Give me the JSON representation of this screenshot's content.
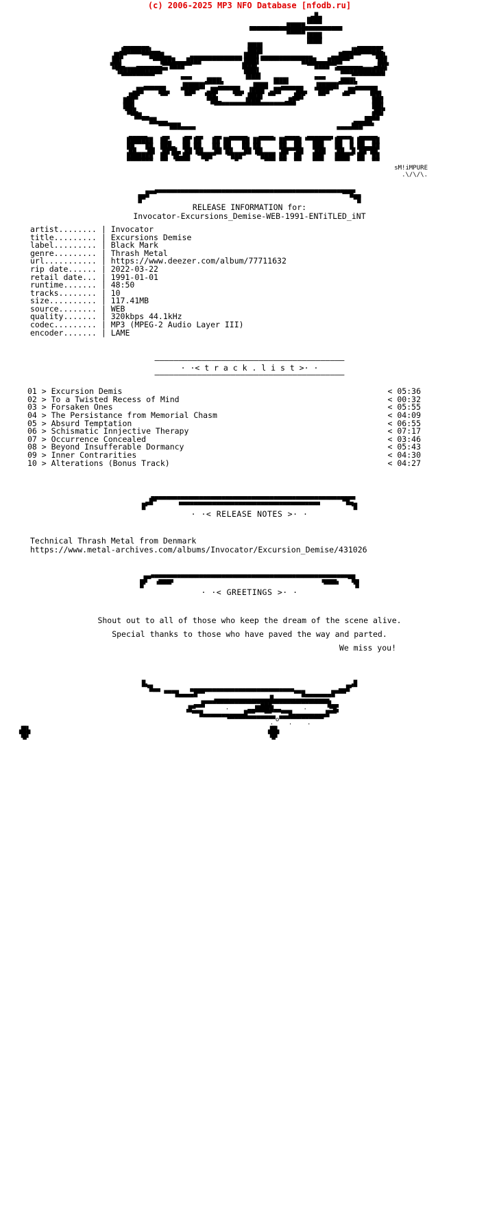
{
  "header": {
    "copyright": "(c) 2006-2025 MP3 NFO Database [nfodb.ru]",
    "color": "#e00000"
  },
  "logo": {
    "name": "invocator-ascii-logo",
    "signature_line1": "sM!iMPURE",
    "signature_line2": ".\\/\\/\\."
  },
  "release": {
    "heading": "RELEASE INFORMATION for:",
    "dirname": "Invocator-Excursions_Demise-WEB-1991-ENTiTLED_iNT",
    "fields": [
      {
        "label": "artist........",
        "sep": "|",
        "value": "Invocator"
      },
      {
        "label": "title.........",
        "sep": "|",
        "value": "Excursions Demise"
      },
      {
        "label": "label.........",
        "sep": "|",
        "value": "Black Mark"
      },
      {
        "label": "genre.........",
        "sep": "|",
        "value": "Thrash Metal"
      },
      {
        "label": "url...........",
        "sep": "|",
        "value": "https://www.deezer.com/album/77711632"
      },
      {
        "label": "rip date......",
        "sep": "|",
        "value": "2022-03-22"
      },
      {
        "label": "retail date...",
        "sep": "|",
        "value": "1991-01-01"
      },
      {
        "label": "runtime.......",
        "sep": "|",
        "value": "48:50"
      },
      {
        "label": "tracks........",
        "sep": "|",
        "value": "10"
      },
      {
        "label": "size..........",
        "sep": "|",
        "value": "117.41MB"
      },
      {
        "label": "source........",
        "sep": "|",
        "value": "WEB"
      },
      {
        "label": "quality.......",
        "sep": "|",
        "value": "320kbps 44.1kHz"
      },
      {
        "label": "codec.........",
        "sep": "|",
        "value": "MP3 (MPEG-2 Audio Layer III)"
      },
      {
        "label": "encoder.......",
        "sep": "|",
        "value": "LAME"
      }
    ]
  },
  "tracklist": {
    "title": "· ·< t r a c k . l i s t >· ·",
    "rule": "————————————————————————————————————————",
    "tracks": [
      {
        "num": "01",
        "marker": ">",
        "title": "Excursion Demis",
        "bracket": "<",
        "time": "05:36"
      },
      {
        "num": "02",
        "marker": ">",
        "title": "To a Twisted Recess of Mind",
        "bracket": "<",
        "time": "00:32"
      },
      {
        "num": "03",
        "marker": ">",
        "title": "Forsaken Ones",
        "bracket": "<",
        "time": "05:55"
      },
      {
        "num": "04",
        "marker": ">",
        "title": "The Persistance from Memorial Chasm",
        "bracket": "<",
        "time": "04:09"
      },
      {
        "num": "05",
        "marker": ">",
        "title": "Absurd Temptation",
        "bracket": "<",
        "time": "06:55"
      },
      {
        "num": "06",
        "marker": ">",
        "title": "Schismatic Innjective Therapy",
        "bracket": "<",
        "time": "07:17"
      },
      {
        "num": "07",
        "marker": ">",
        "title": "Occurrence Concealed",
        "bracket": "<",
        "time": "03:46"
      },
      {
        "num": "08",
        "marker": ">",
        "title": "Beyond Insufferable Dormancy",
        "bracket": "<",
        "time": "05:43"
      },
      {
        "num": "09",
        "marker": ">",
        "title": "Inner Contrarities",
        "bracket": "<",
        "time": "04:30"
      },
      {
        "num": "10",
        "marker": ">",
        "title": "Alterations (Bonus Track)",
        "bracket": "<",
        "time": "04:27"
      }
    ]
  },
  "notes": {
    "title": "· ·< RELEASE NOTES >· ·",
    "line1": "Technical Thrash Metal from Denmark",
    "line2": "https://www.metal-archives.com/albums/Invocator/Excursion_Demise/431026"
  },
  "greetings": {
    "title": "· ·< GREETINGS >· ·",
    "line1": "Shout out to all of those who keep the dream of the scene alive.",
    "line2": "Special thanks to those who have paved the way and parted.",
    "line3": "We miss you!"
  }
}
